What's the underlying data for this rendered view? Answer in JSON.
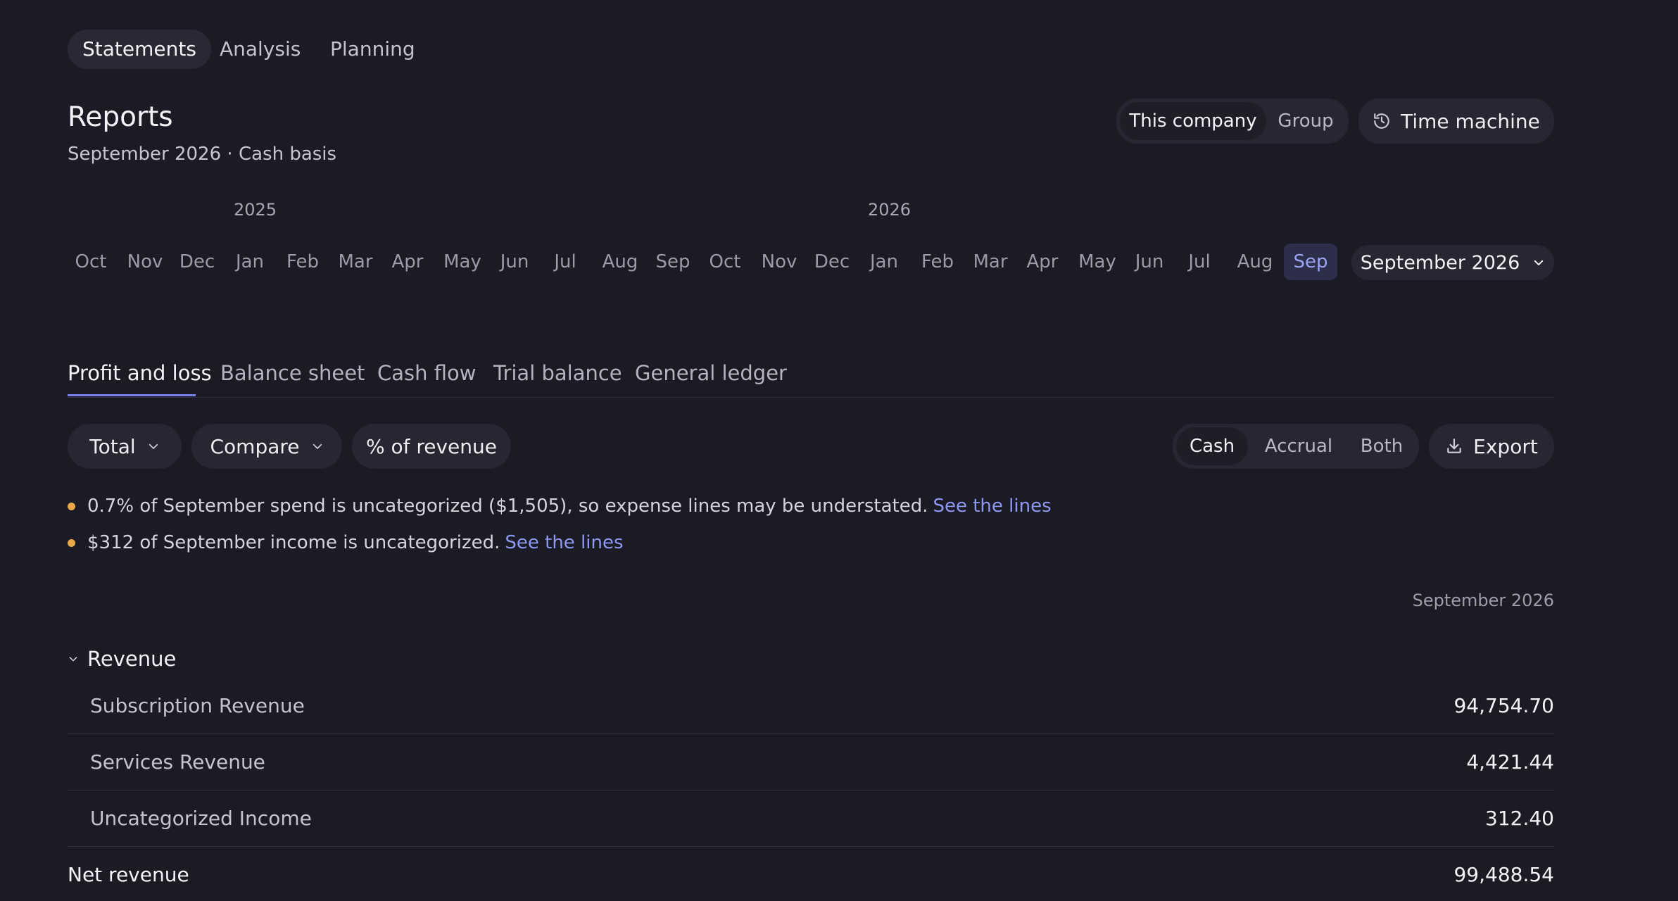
{
  "top_nav": {
    "items": [
      {
        "label": "Statements"
      },
      {
        "label": "Analysis"
      },
      {
        "label": "Planning"
      }
    ]
  },
  "header": {
    "title": "Reports",
    "subtitle": "September 2026 · Cash basis"
  },
  "scope": {
    "options": [
      {
        "label": "This company"
      },
      {
        "label": "Group"
      }
    ],
    "selected": "This company"
  },
  "time_machine": {
    "label": "Time machine",
    "icon": "history-icon"
  },
  "timeline": {
    "years": [
      {
        "label": "2025"
      },
      {
        "label": "2026"
      }
    ],
    "months": [
      {
        "label": "Oct"
      },
      {
        "label": "Nov"
      },
      {
        "label": "Dec"
      },
      {
        "label": "Jan"
      },
      {
        "label": "Feb"
      },
      {
        "label": "Mar"
      },
      {
        "label": "Apr"
      },
      {
        "label": "May"
      },
      {
        "label": "Jun"
      },
      {
        "label": "Jul"
      },
      {
        "label": "Aug"
      },
      {
        "label": "Sep"
      },
      {
        "label": "Oct"
      },
      {
        "label": "Nov"
      },
      {
        "label": "Dec"
      },
      {
        "label": "Jan"
      },
      {
        "label": "Feb"
      },
      {
        "label": "Mar"
      },
      {
        "label": "Apr"
      },
      {
        "label": "May"
      },
      {
        "label": "Jun"
      },
      {
        "label": "Jul"
      },
      {
        "label": "Aug"
      },
      {
        "label": "Sep"
      }
    ],
    "selected_month": "Sep 2026",
    "period_select": {
      "value": "September 2026"
    }
  },
  "report_tabs": {
    "items": [
      {
        "label": "Profit and loss"
      },
      {
        "label": "Balance sheet"
      },
      {
        "label": "Cash flow"
      },
      {
        "label": "Trial balance"
      },
      {
        "label": "General ledger"
      }
    ],
    "active": "Profit and loss"
  },
  "toolbar": {
    "total_label": "Total",
    "compare_label": "Compare",
    "percent_label": "% of revenue",
    "basis": {
      "options": [
        {
          "label": "Cash"
        },
        {
          "label": "Accrual"
        },
        {
          "label": "Both"
        }
      ],
      "selected": "Cash"
    },
    "export_label": "Export"
  },
  "warnings": [
    {
      "text": "0.7% of September spend is uncategorized ($1,505), so expense lines may be understated.",
      "link": "See the lines"
    },
    {
      "text": "$312 of September income is uncategorized.",
      "link": "See the lines"
    }
  ],
  "report": {
    "column_header": "September 2026",
    "section": {
      "label": "Revenue"
    },
    "lines": [
      {
        "label": "Subscription Revenue",
        "value": "94,754.70"
      },
      {
        "label": "Services Revenue",
        "value": "4,421.44"
      },
      {
        "label": "Uncategorized Income",
        "value": "312.40"
      }
    ],
    "total": {
      "label": "Net revenue",
      "value": "99,488.54"
    }
  },
  "colors": {
    "background": "#1b1b25",
    "surface": "#272733",
    "accent": "#7b84e6",
    "link": "#8f97f0",
    "warning_dot": "#e9a94a"
  }
}
